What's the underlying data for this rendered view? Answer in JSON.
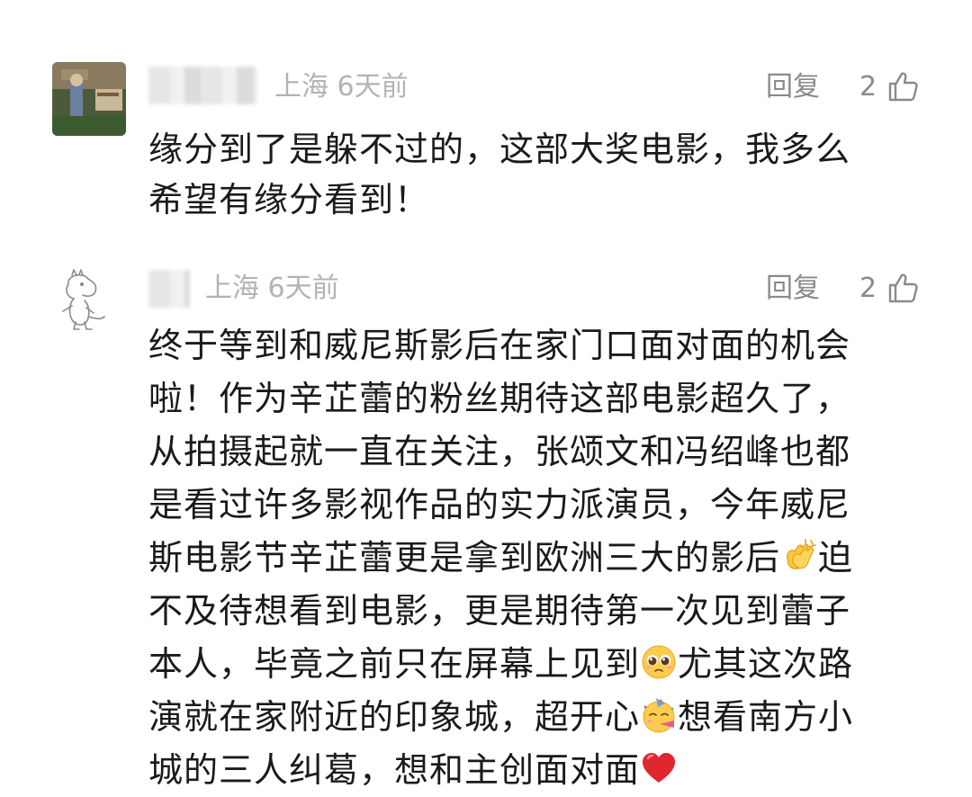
{
  "comments": [
    {
      "location": "上海",
      "time": "6天前",
      "reply_label": "回复",
      "like_count": "2",
      "lines": [
        "缘分到了是躲不过的，这部大奖电影，我多么",
        "希望有缘分看到！"
      ]
    },
    {
      "location": "上海",
      "time": "6天前",
      "reply_label": "回复",
      "like_count": "2",
      "lines": [
        "终于等到和威尼斯影后在家门口面对面的机会",
        "啦！作为辛芷蕾的粉丝期待这部电影超久了，",
        "从拍摄起就一直在关注，张颂文和冯绍峰也都",
        "是看过许多影视作品的实力派演员，今年威尼",
        "斯电影节辛芷蕾更是拿到欧洲三大的影后",
        "不及待想看到电影，更是期待第一次见到蕾子",
        "本人，毕竟之前只在屏幕上见到",
        "演就在家附近的印象城，超开心",
        "城的三人纠葛，想和主创面对面"
      ],
      "inline_after": [
        "迫",
        "尤其这次路",
        "想看南方小"
      ]
    }
  ],
  "icons": {
    "like": "thumbs-up-icon",
    "clap": "clapping-hands-emoji",
    "pleading": "pleading-face-emoji",
    "party": "partying-face-emoji",
    "heart": "red-heart-emoji"
  },
  "colors": {
    "meta": "#b3b3b3",
    "action": "#8a8a8a",
    "body_text": "#1a1a1a"
  }
}
